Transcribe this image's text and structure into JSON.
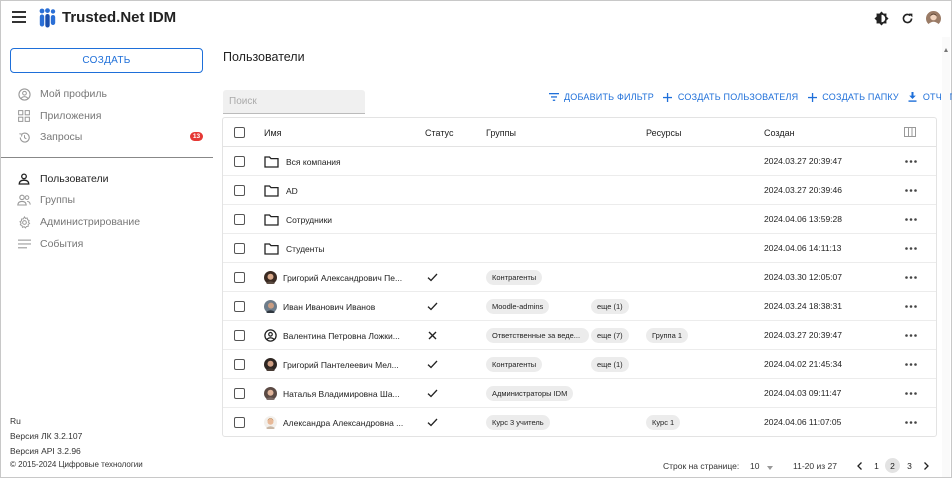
{
  "app": {
    "title": "Trusted.Net IDM",
    "colors": {
      "accent": "#1e6fd9",
      "badge": "#e53935",
      "logo": "#2a6fd6"
    }
  },
  "sidebar": {
    "create_label": "СОЗДАТЬ",
    "items": [
      {
        "label": "Мой профиль",
        "icon": "account-circle-icon"
      },
      {
        "label": "Приложения",
        "icon": "apps-grid-icon"
      },
      {
        "label": "Запросы",
        "icon": "history-icon",
        "badge": "13"
      },
      {
        "label": "Пользователи",
        "icon": "person-icon",
        "active": true
      },
      {
        "label": "Группы",
        "icon": "group-icon"
      },
      {
        "label": "Администрирование",
        "icon": "gear-icon"
      },
      {
        "label": "События",
        "icon": "list-icon"
      }
    ],
    "footer": {
      "language": "Ru",
      "lk_version": "Версия ЛК 3.2.107",
      "api_version": "Версия API 3.2.96",
      "copyright": "© 2015-2024 Цифровые технологии"
    }
  },
  "main": {
    "title": "Пользователи",
    "search_placeholder": "Поиск",
    "actions": {
      "add_filter": "ДОБАВИТЬ ФИЛЬТР",
      "create_user": "СОЗДАТЬ ПОЛЬЗОВАТЕЛЯ",
      "create_folder": "СОЗДАТЬ ПАПКУ",
      "reports": "ОТЧЕТЫ"
    },
    "columns": {
      "name": "Имя",
      "status": "Статус",
      "groups": "Группы",
      "resources": "Ресурсы",
      "created": "Создан"
    },
    "rows": [
      {
        "type": "folder",
        "name": "Вся компания",
        "created": "2024.03.27 20:39:47"
      },
      {
        "type": "folder",
        "name": "AD",
        "created": "2024.03.27 20:39:46"
      },
      {
        "type": "folder",
        "name": "Сотрудники",
        "created": "2024.04.06 13:59:28"
      },
      {
        "type": "folder",
        "name": "Студенты",
        "created": "2024.04.06 14:11:13"
      },
      {
        "type": "user",
        "avatar": "photo",
        "name": "Григорий Александрович Пе...",
        "status": "active",
        "group": "Контрагенты",
        "created": "2024.03.30 12:05:07"
      },
      {
        "type": "user",
        "avatar": "photo",
        "name": "Иван Иванович Иванов",
        "status": "active",
        "group": "Moodle-admins",
        "more": "еще (1)",
        "created": "2024.03.24 18:38:31"
      },
      {
        "type": "user",
        "avatar": "default",
        "name": "Валентина Петровна Ложки...",
        "status": "blocked",
        "group": "Ответственные за веде...",
        "more": "еще (7)",
        "resource": "Группа 1",
        "created": "2024.03.27 20:39:47"
      },
      {
        "type": "user",
        "avatar": "photo",
        "name": "Григорий Пантелеевич Мел...",
        "status": "active",
        "group": "Контрагенты",
        "more": "еще (1)",
        "created": "2024.04.02 21:45:34"
      },
      {
        "type": "user",
        "avatar": "photo",
        "name": "Наталья Владимировна Ша...",
        "status": "active",
        "group": "Администраторы IDM",
        "created": "2024.04.03 09:11:47"
      },
      {
        "type": "user",
        "avatar": "photo",
        "name": "Александра Александровна ...",
        "status": "active",
        "group": "Курс 3 учитель",
        "resource": "Курс 1",
        "created": "2024.04.06 11:07:05"
      }
    ]
  },
  "pagination": {
    "rows_per_page_label": "Строк на странице:",
    "rows_per_page": "10",
    "range": "11-20 из 27",
    "pages": [
      "1",
      "2",
      "3"
    ],
    "current_page": "2"
  }
}
